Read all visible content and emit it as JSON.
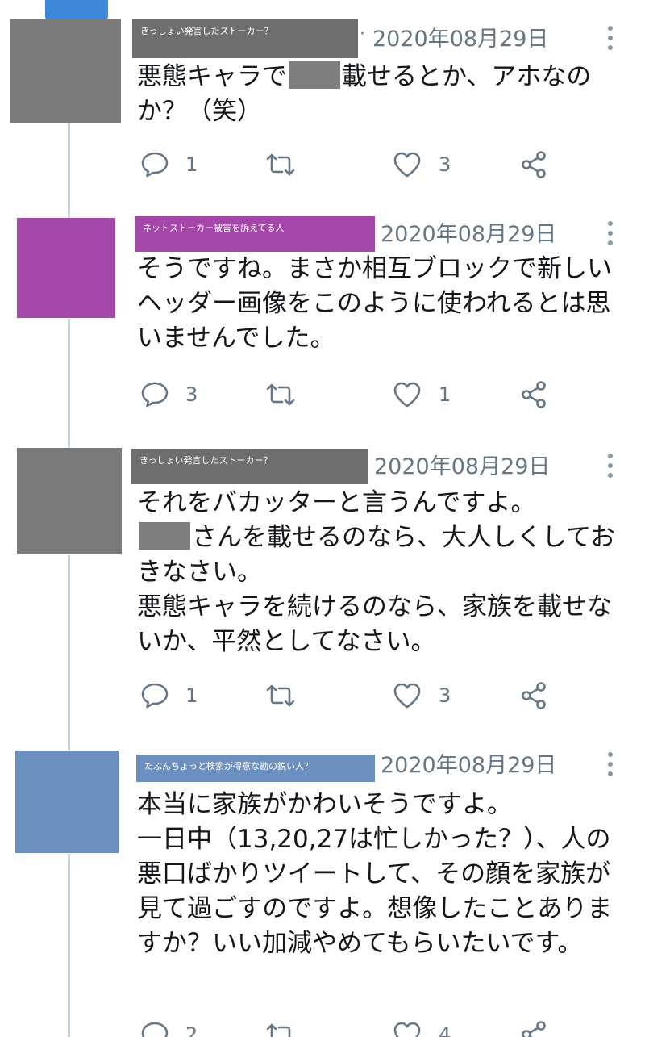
{
  "tweets": [
    {
      "name": "きっしょい発言したストーカー？",
      "name_bg": "#6e6e6e",
      "avatar_color": "#7a7a7a",
      "date": "2020年08月29日",
      "show_dot": true,
      "paragraphs": [
        {
          "pre": "悪態キャラで",
          "redacted": true,
          "post": "載せるとか、アホなのか？（笑）"
        }
      ],
      "replies": "1",
      "retweets": "",
      "likes": "3"
    },
    {
      "name": "ネットストーカー被害を訴えてる人",
      "name_bg": "#a547a8",
      "avatar_color": "#a547a8",
      "date": "2020年08月29日",
      "show_dot": false,
      "paragraphs": [
        {
          "pre": "そうですね。まさか相互ブロックで新しいヘッダー画像をこのように使われるとは思いませんでした。",
          "redacted": false,
          "post": ""
        }
      ],
      "replies": "3",
      "retweets": "",
      "likes": "1"
    },
    {
      "name": "きっしょい発言したストーカー？",
      "name_bg": "#6e6e6e",
      "avatar_color": "#7a7a7a",
      "date": "2020年08月29日",
      "show_dot": false,
      "paragraphs": [
        {
          "pre": "それをバカッターと言うんですよ。",
          "redacted": false,
          "post": ""
        },
        {
          "pre": "",
          "redacted": true,
          "post": "さんを載せるのなら、大人しくしておきなさい。"
        },
        {
          "pre": "悪態キャラを続けるのなら、家族を載せないか、平然としてなさい。",
          "redacted": false,
          "post": ""
        }
      ],
      "replies": "1",
      "retweets": "",
      "likes": "3"
    },
    {
      "name": "たぶんちょっと検索が得意な勘の鋭い人？",
      "name_bg": "#6b8fbe",
      "avatar_color": "#6b8fbe",
      "date": "2020年08月29日",
      "show_dot": false,
      "paragraphs": [
        {
          "pre": "本当に家族がかわいそうですよ。",
          "redacted": false,
          "post": ""
        },
        {
          "pre": "一日中（13,20,27は忙しかった？）、人の悪口ばかりツイートして、その顔を家族が見て過ごすのですよ。想像したことありますか？いい加減やめてもらいたいです。",
          "redacted": false,
          "post": ""
        }
      ],
      "replies": "2",
      "retweets": "",
      "likes": "4"
    }
  ],
  "icons": {
    "reply": "reply-icon",
    "retweet": "retweet-icon",
    "like": "heart-icon",
    "share": "share-icon",
    "more": "more-vertical-icon"
  },
  "colors": {
    "icon": "#657786",
    "thread_line": "#c8d3dc",
    "redaction": "#7f7f7f"
  }
}
